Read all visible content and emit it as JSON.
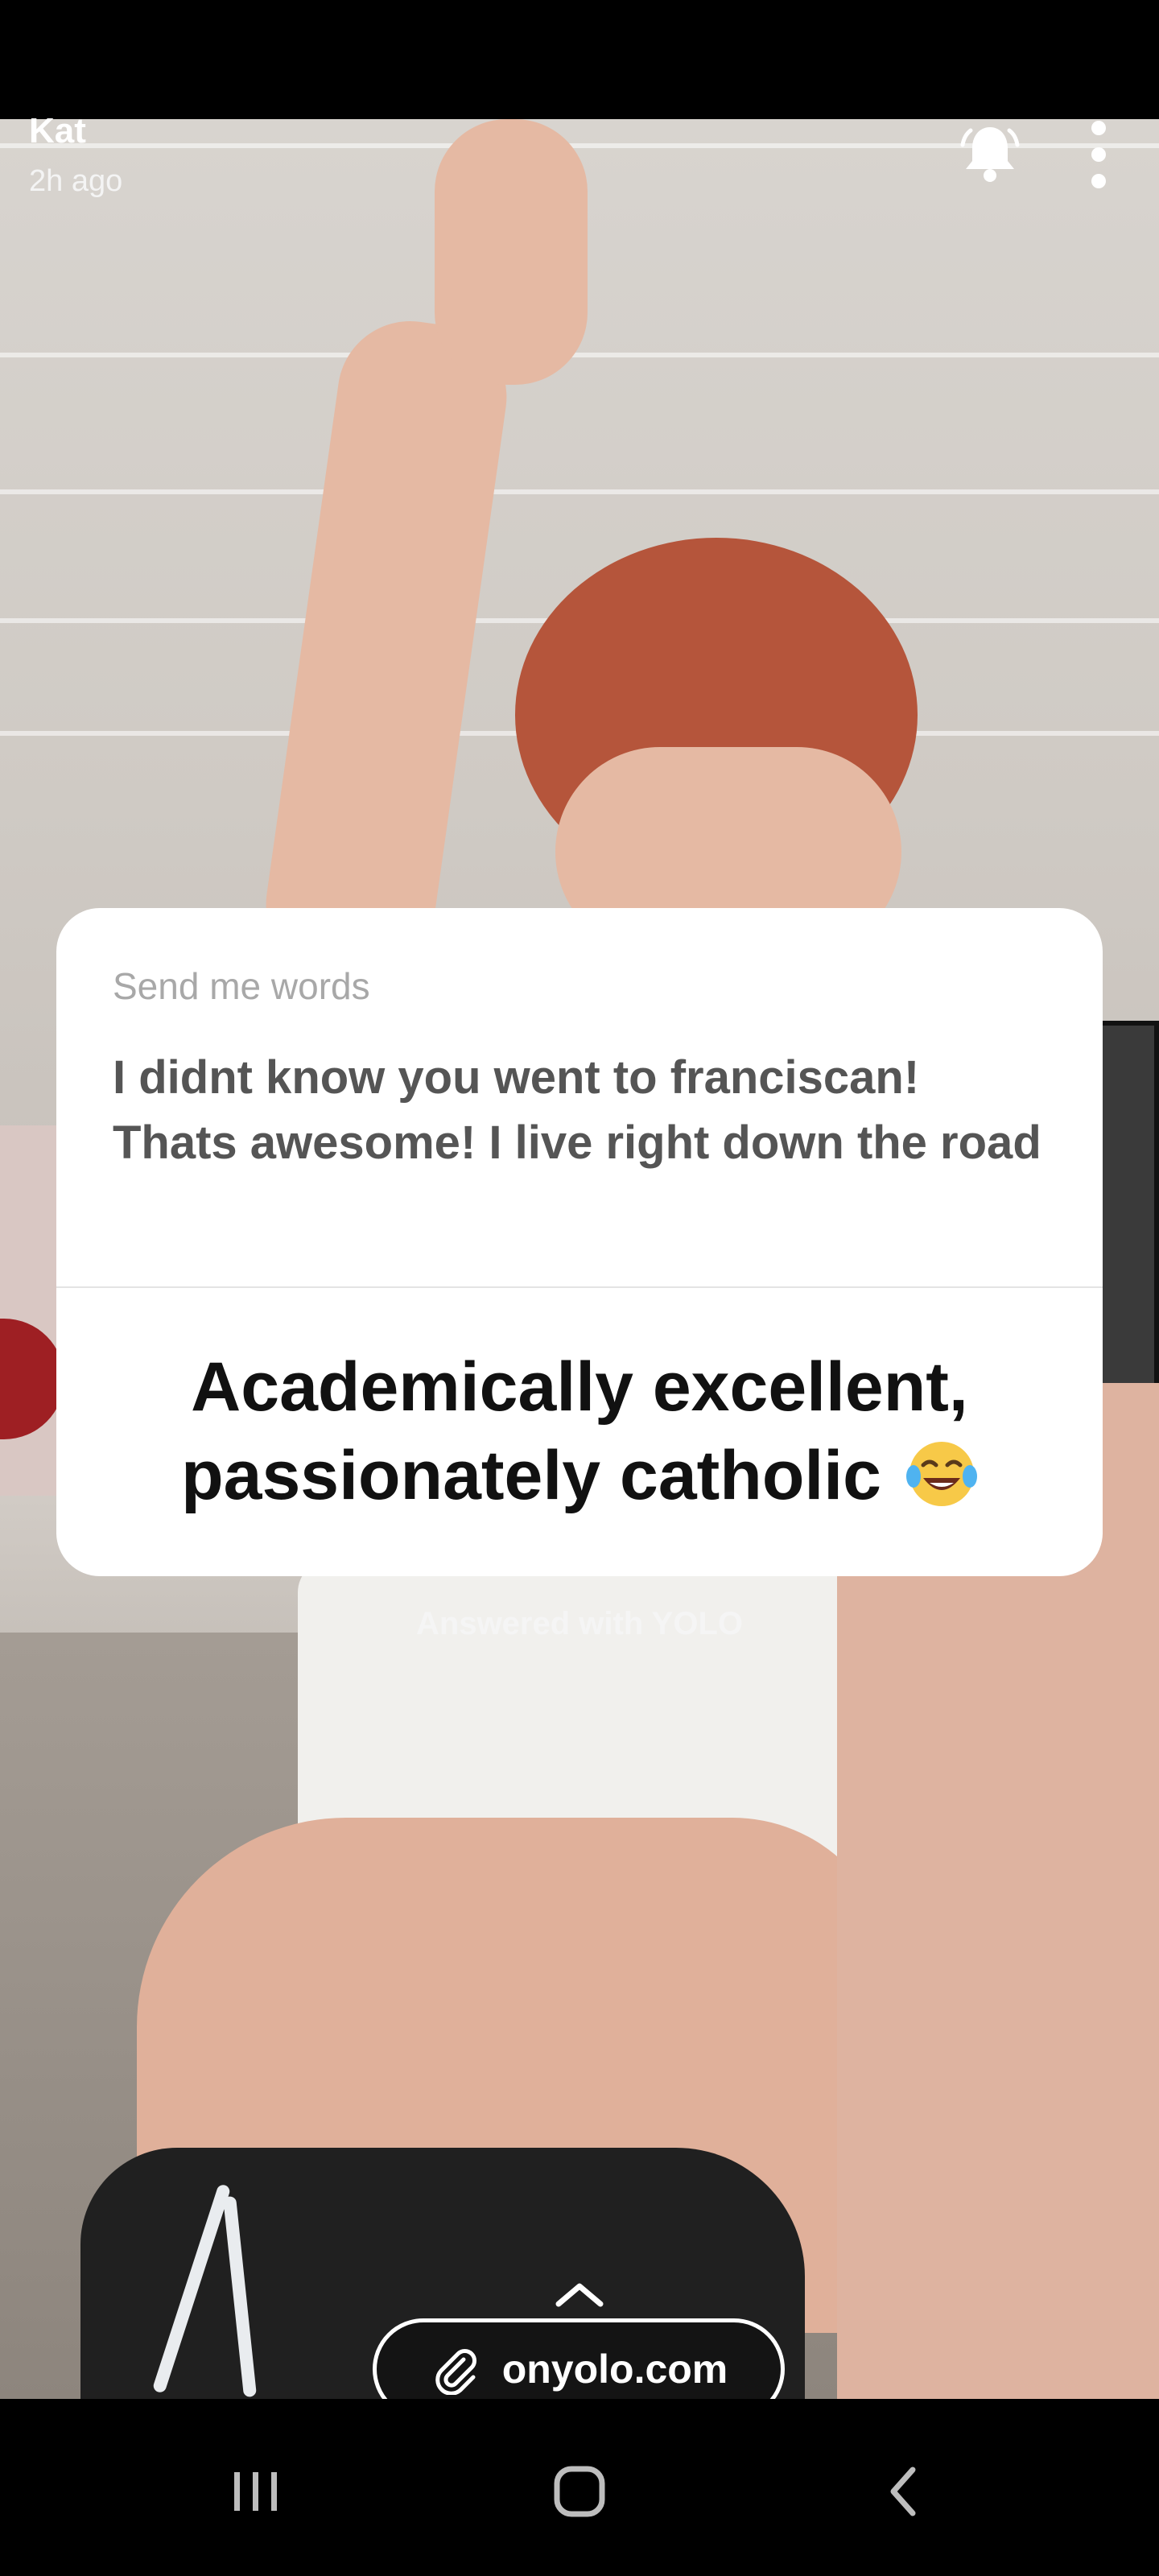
{
  "header": {
    "user_name": "Kat",
    "time_ago": "2h ago"
  },
  "card": {
    "label": "Send me words",
    "question": "I didnt know you went to franciscan! Thats awesome! I live right down the road",
    "answer": "Academically excellent, passionately catholic",
    "answer_emoji": "laughing-tears-emoji"
  },
  "answered_with": "Answered with YOLO",
  "link": {
    "text": "onyolo.com",
    "icon": "paperclip-icon"
  },
  "icons": {
    "bell": "bell-icon",
    "more": "more-vertical-icon",
    "chevron": "chevron-up-icon"
  },
  "nav": {
    "recent": "recent-apps-icon",
    "home": "home-icon",
    "back": "back-icon"
  },
  "colors": {
    "card_bg": "#ffffff",
    "label": "#a8a8a8",
    "question": "#555555",
    "answer": "#111111"
  }
}
